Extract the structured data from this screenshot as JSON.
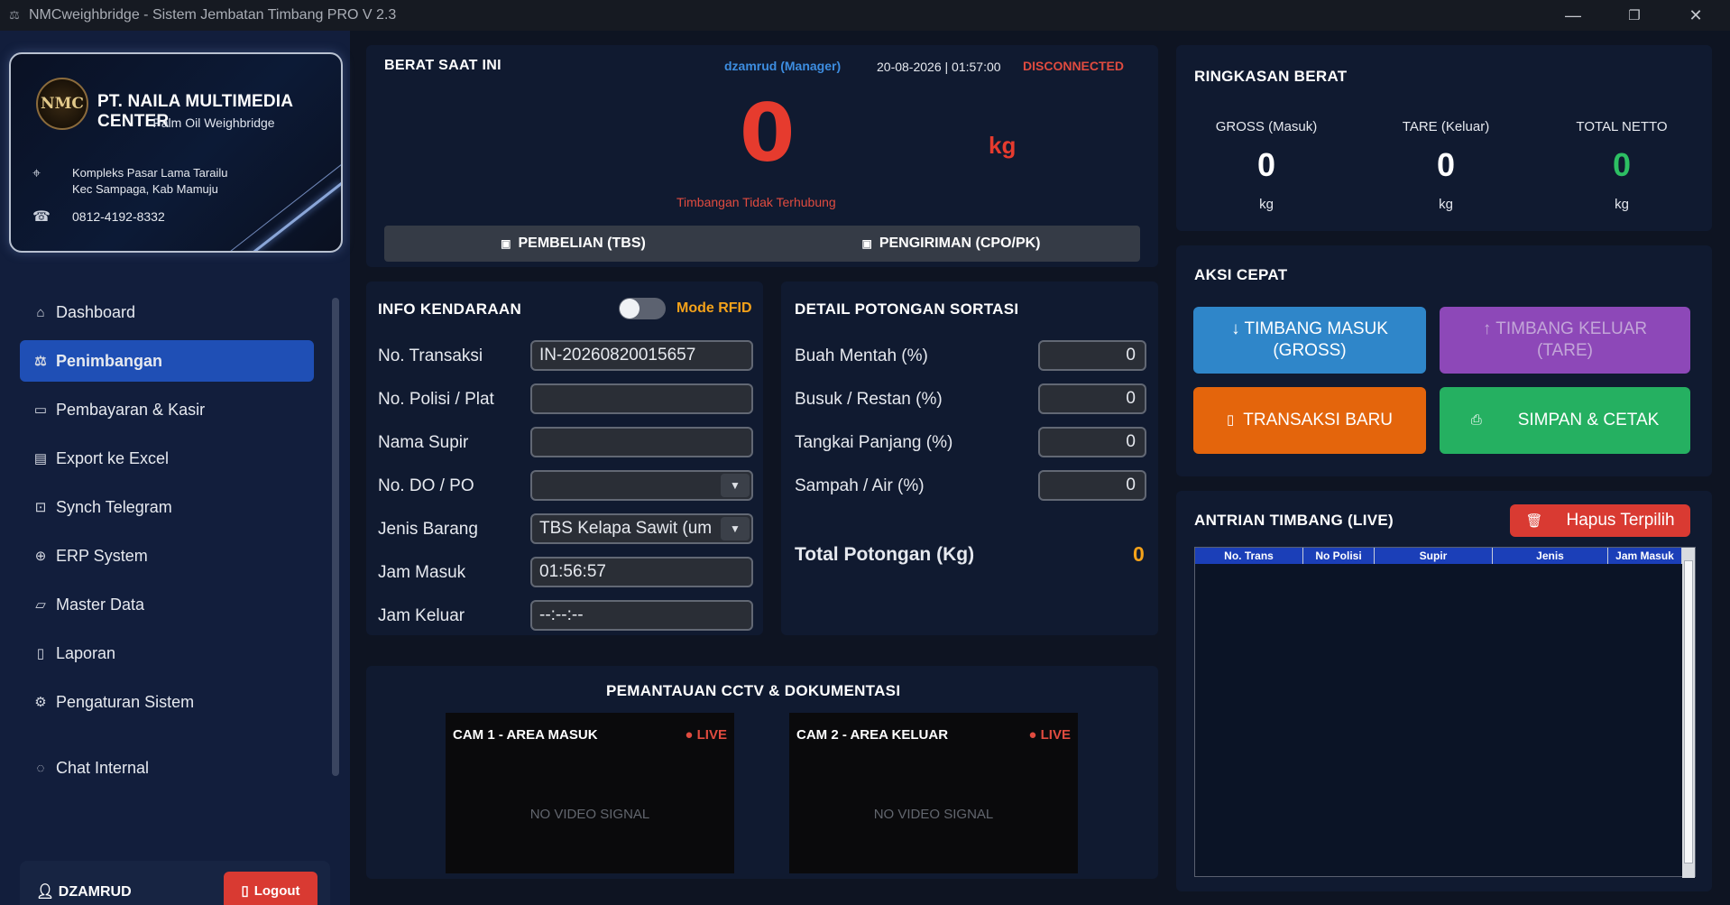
{
  "window": {
    "title": "NMCweighbridge - Sistem Jembatan Timbang PRO V 2.3",
    "minimize": "—",
    "maximize": "❐",
    "close": "✕"
  },
  "company": {
    "emblem": "NMC",
    "name": "PT. NAILA MULTIMEDIA CENTER",
    "subtitle": "Palm Oil Weighbridge",
    "address_line1": "Kompleks Pasar Lama Tarailu",
    "address_line2": "Kec Sampaga, Kab Mamuju",
    "phone": "0812-4192-8332"
  },
  "nav": {
    "items": [
      {
        "label": "Dashboard",
        "icon": "home-icon"
      },
      {
        "label": "Penimbangan",
        "icon": "scale-icon",
        "active": true
      },
      {
        "label": "Pembayaran & Kasir",
        "icon": "card-icon"
      },
      {
        "label": "Export ke Excel",
        "icon": "excel-icon"
      },
      {
        "label": "Synch Telegram",
        "icon": "telegram-icon"
      },
      {
        "label": "ERP System",
        "icon": "globe-icon"
      },
      {
        "label": "Master Data",
        "icon": "folder-icon"
      },
      {
        "label": "Laporan",
        "icon": "report-icon"
      },
      {
        "label": "Pengaturan Sistem",
        "icon": "gear-icon"
      },
      {
        "label": "Chat Internal",
        "icon": "chat-icon"
      }
    ]
  },
  "user": {
    "name": "DZAMRUD",
    "logout": "Logout"
  },
  "weight": {
    "title": "BERAT SAAT INI",
    "user_role": "dzamrud (Manager)",
    "datetime": "20-08-2026 | 01:57:00",
    "connection": "DISCONNECTED",
    "value": "0",
    "unit": "kg",
    "status": "Timbangan Tidak Terhubung",
    "mode_tabs": [
      "PEMBELIAN (TBS)",
      "PENGIRIMAN (CPO/PK)"
    ]
  },
  "vehicle": {
    "title": "INFO KENDARAAN",
    "rfid_label": "Mode RFID",
    "fields": {
      "transaksi": {
        "label": "No. Transaksi",
        "value": "IN-20260820015657"
      },
      "polisi": {
        "label": "No. Polisi / Plat",
        "value": ""
      },
      "supir": {
        "label": "Nama Supir",
        "value": ""
      },
      "do_po": {
        "label": "No. DO / PO",
        "value": ""
      },
      "jenis": {
        "label": "Jenis Barang",
        "value": "TBS Kelapa Sawit (um"
      },
      "jam_masuk": {
        "label": "Jam Masuk",
        "value": "01:56:57"
      },
      "jam_keluar": {
        "label": "Jam Keluar",
        "value": "--:--:--"
      }
    }
  },
  "sortasi": {
    "title": "DETAIL POTONGAN SORTASI",
    "fields": [
      {
        "label": "Buah Mentah (%)",
        "value": "0"
      },
      {
        "label": "Busuk / Restan (%)",
        "value": "0"
      },
      {
        "label": "Tangkai Panjang (%)",
        "value": "0"
      },
      {
        "label": "Sampah / Air (%)",
        "value": "0"
      }
    ],
    "total_label": "Total Potongan (Kg)",
    "total_value": "0"
  },
  "summary": {
    "title": "RINGKASAN BERAT",
    "gross": {
      "label": "GROSS (Masuk)",
      "value": "0",
      "unit": "kg"
    },
    "tare": {
      "label": "TARE (Keluar)",
      "value": "0",
      "unit": "kg"
    },
    "netto": {
      "label": "TOTAL NETTO",
      "value": "0",
      "unit": "kg"
    }
  },
  "quick": {
    "title": "AKSI CEPAT",
    "masuk_line1": "↓ TIMBANG MASUK",
    "masuk_line2": "(GROSS)",
    "keluar_line1": "↑ TIMBANG KELUAR",
    "keluar_line2": "(TARE)",
    "baru": "TRANSAKSI BARU",
    "simpan": "SIMPAN & CETAK",
    "colors": {
      "masuk": "#2f86c9",
      "keluar": "#8d48b8",
      "baru": "#e4650c",
      "simpan": "#25b061"
    }
  },
  "queue": {
    "title": "ANTRIAN TIMBANG (LIVE)",
    "delete_label": "Hapus Terpilih",
    "columns": [
      "No. Trans",
      "No Polisi",
      "Supir",
      "Jenis",
      "Jam Masuk"
    ]
  },
  "cctv": {
    "title": "PEMANTAUAN CCTV & DOKUMENTASI",
    "cam1": {
      "title": "CAM 1 - AREA MASUK",
      "status": "● LIVE",
      "signal": "NO VIDEO SIGNAL"
    },
    "cam2": {
      "title": "CAM 2 - AREA KELUAR",
      "status": "● LIVE",
      "signal": "NO VIDEO SIGNAL"
    }
  }
}
